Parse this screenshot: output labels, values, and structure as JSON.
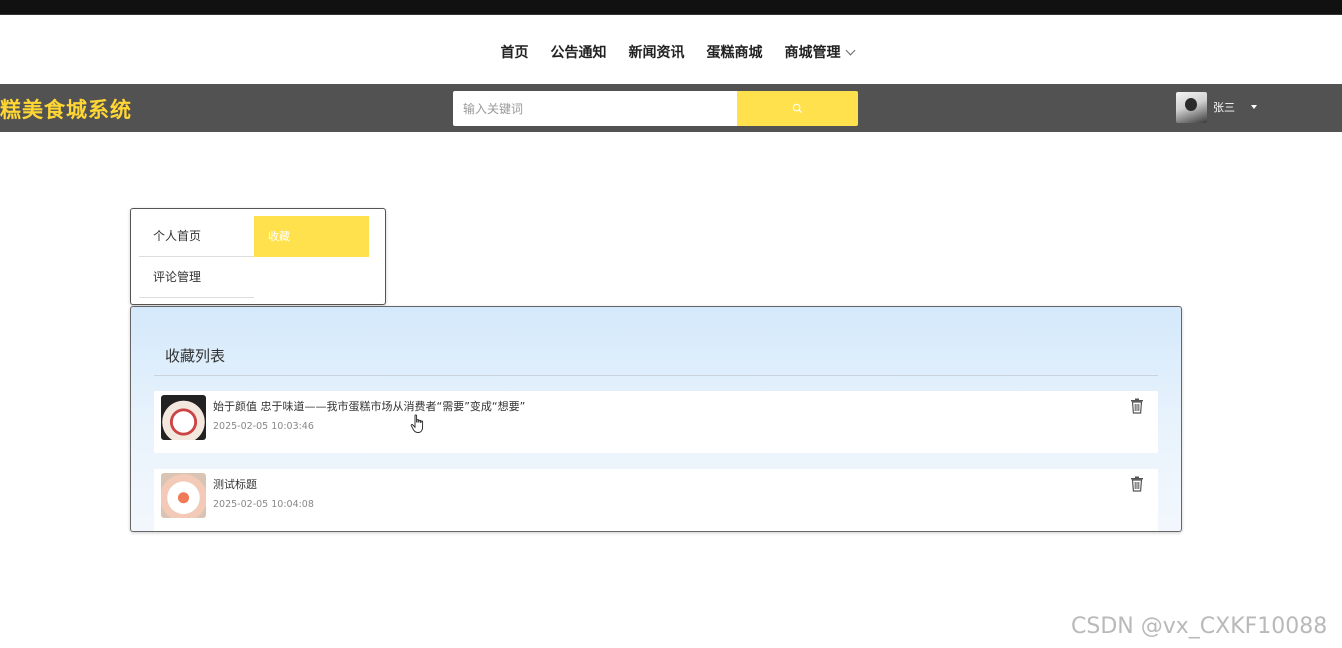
{
  "top_nav": {
    "items": [
      "首页",
      "公告通知",
      "新闻资讯",
      "蛋糕商城",
      "商城管理"
    ]
  },
  "header": {
    "logo": "糕美食城系统",
    "search": {
      "placeholder": "输入关键词",
      "value": ""
    },
    "search_icon": "search-icon",
    "user": {
      "name": "张三"
    }
  },
  "side_menu": {
    "items": [
      {
        "label": "个人首页",
        "active": false
      },
      {
        "label": "收藏",
        "active": true
      },
      {
        "label": "评论管理",
        "active": false
      }
    ]
  },
  "favorites": {
    "title": "收藏列表",
    "items": [
      {
        "title": "始于颜值 忠于味道——我市蛋糕市场从消费者“需要”变成“想要”",
        "time": "2025-02-05 10:03:46",
        "action_icon": "trash-icon"
      },
      {
        "title": "测试标题",
        "time": "2025-02-05 10:04:08",
        "action_icon": "trash-icon"
      }
    ]
  },
  "watermark": "CSDN @vx_CXKF10088",
  "colors": {
    "accent": "#ffe14d",
    "header_bg": "#525252",
    "logo": "#ffd633"
  }
}
